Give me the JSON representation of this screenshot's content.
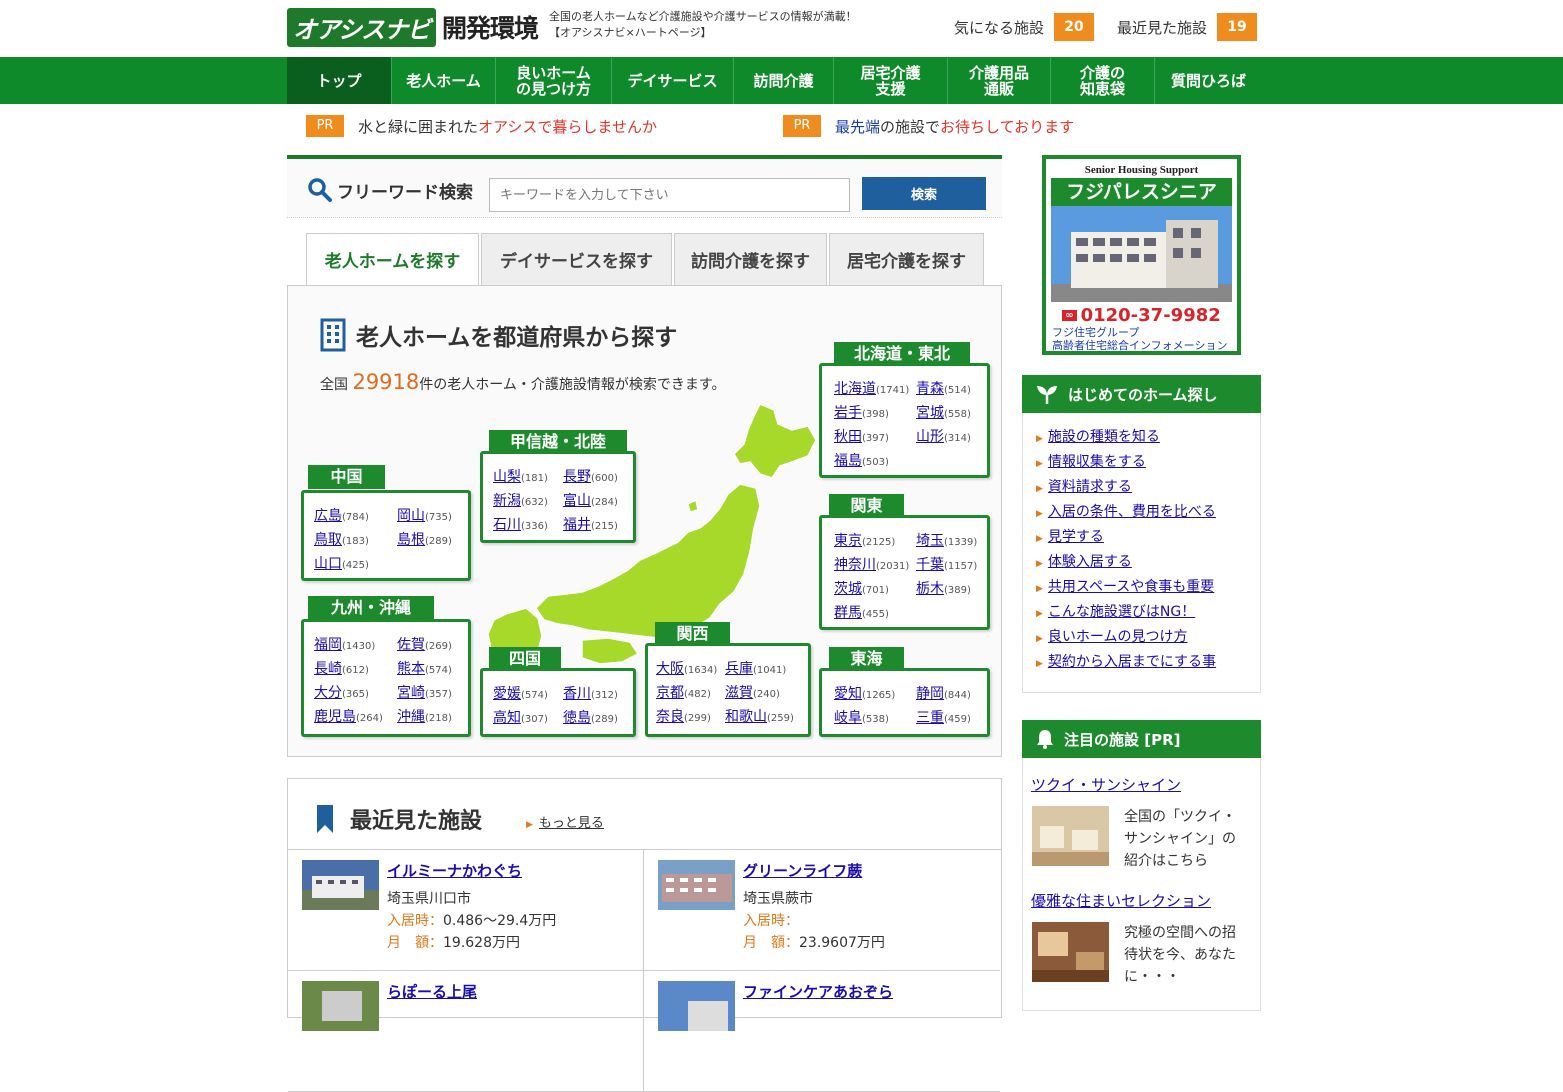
{
  "header": {
    "logo_brand": "オアシスナビ",
    "logo_env": "開発環境",
    "desc_line1": "全国の老人ホームなど介護施設や介護サービスの情報が満載！",
    "desc_line2": "【オアシスナビ×ハートページ】",
    "favorites_label": "気になる施設",
    "favorites_count": "20",
    "recent_label": "最近見た施設",
    "recent_count": "19"
  },
  "nav": [
    {
      "l1": "トップ",
      "l2": ""
    },
    {
      "l1": "老人ホーム",
      "l2": ""
    },
    {
      "l1": "良いホーム",
      "l2": "の見つけ方"
    },
    {
      "l1": "デイサービス",
      "l2": ""
    },
    {
      "l1": "訪問介護",
      "l2": ""
    },
    {
      "l1": "居宅介護",
      "l2": "支援"
    },
    {
      "l1": "介護用品",
      "l2": "通販"
    },
    {
      "l1": "介護の",
      "l2": "知恵袋"
    },
    {
      "l1": "質問ひろば",
      "l2": ""
    }
  ],
  "pr": [
    {
      "tag": "PR",
      "pre": "水と緑に囲まれた",
      "hl": "オアシスで暮らしませんか",
      "post": ""
    },
    {
      "tag": "PR",
      "pre": "最先端",
      "mid": "の施設で",
      "hl": "お待ちしております"
    }
  ],
  "search": {
    "label": "フリーワード検索",
    "placeholder": "キーワードを入力して下さい",
    "button": "検索"
  },
  "tabs": [
    "老人ホームを探す",
    "デイサービスを探す",
    "訪問介護を探す",
    "居宅介護を探す"
  ],
  "map": {
    "title": "老人ホームを都道府県から探す",
    "count_pre": "全国",
    "count": "29918",
    "count_post": "件の老人ホーム・介護施設情報が検索できます。",
    "regions": {
      "hokkaido": {
        "name": "北海道・東北",
        "prefs": [
          [
            "北海道",
            "(1741)"
          ],
          [
            "青森",
            "(514)"
          ],
          [
            "岩手",
            "(398)"
          ],
          [
            "宮城",
            "(558)"
          ],
          [
            "秋田",
            "(397)"
          ],
          [
            "山形",
            "(314)"
          ],
          [
            "福島",
            "(503)"
          ]
        ]
      },
      "kanto": {
        "name": "関東",
        "prefs": [
          [
            "東京",
            "(2125)"
          ],
          [
            "埼玉",
            "(1339)"
          ],
          [
            "神奈川",
            "(2031)"
          ],
          [
            "千葉",
            "(1157)"
          ],
          [
            "茨城",
            "(701)"
          ],
          [
            "栃木",
            "(389)"
          ],
          [
            "群馬",
            "(455)"
          ]
        ]
      },
      "tokai": {
        "name": "東海",
        "prefs": [
          [
            "愛知",
            "(1265)"
          ],
          [
            "静岡",
            "(844)"
          ],
          [
            "岐阜",
            "(538)"
          ],
          [
            "三重",
            "(459)"
          ]
        ]
      },
      "koshin": {
        "name": "甲信越・北陸",
        "prefs": [
          [
            "山梨",
            "(181)"
          ],
          [
            "長野",
            "(600)"
          ],
          [
            "新潟",
            "(632)"
          ],
          [
            "富山",
            "(284)"
          ],
          [
            "石川",
            "(336)"
          ],
          [
            "福井",
            "(215)"
          ]
        ]
      },
      "kansai": {
        "name": "関西",
        "prefs": [
          [
            "大阪",
            "(1634)"
          ],
          [
            "兵庫",
            "(1041)"
          ],
          [
            "京都",
            "(482)"
          ],
          [
            "滋賀",
            "(240)"
          ],
          [
            "奈良",
            "(299)"
          ],
          [
            "和歌山",
            "(259)"
          ]
        ]
      },
      "chugoku": {
        "name": "中国",
        "prefs": [
          [
            "広島",
            "(784)"
          ],
          [
            "岡山",
            "(735)"
          ],
          [
            "鳥取",
            "(183)"
          ],
          [
            "島根",
            "(289)"
          ],
          [
            "山口",
            "(425)"
          ]
        ]
      },
      "shikoku": {
        "name": "四国",
        "prefs": [
          [
            "愛媛",
            "(574)"
          ],
          [
            "香川",
            "(312)"
          ],
          [
            "高知",
            "(307)"
          ],
          [
            "徳島",
            "(289)"
          ]
        ]
      },
      "kyushu": {
        "name": "九州・沖縄",
        "prefs": [
          [
            "福岡",
            "(1430)"
          ],
          [
            "佐賀",
            "(269)"
          ],
          [
            "長崎",
            "(612)"
          ],
          [
            "熊本",
            "(574)"
          ],
          [
            "大分",
            "(365)"
          ],
          [
            "宮崎",
            "(357)"
          ],
          [
            "鹿児島",
            "(264)"
          ],
          [
            "沖縄",
            "(218)"
          ]
        ]
      }
    }
  },
  "recent": {
    "title": "最近見た施設",
    "more": "もっと見る",
    "items": [
      {
        "name": "イルミーナかわぐち",
        "addr": "埼玉県川口市",
        "move_label": "入居時：",
        "move": "0.486〜29.4万円",
        "month_label": "月　額：",
        "month": "19.628万円"
      },
      {
        "name": "グリーンライフ蕨",
        "addr": "埼玉県蕨市",
        "move_label": "入居時：",
        "move": "",
        "month_label": "月　額：",
        "month": "23.9607万円"
      },
      {
        "name": "らぽーる上尾",
        "addr": "",
        "move_label": "",
        "move": "",
        "month_label": "",
        "month": ""
      },
      {
        "name": "ファインケアあおぞら",
        "addr": "",
        "move_label": "",
        "move": "",
        "month_label": "",
        "month": ""
      }
    ]
  },
  "ad": {
    "sub": "Senior Housing Support",
    "title": "フジパレスシニア",
    "tel": "0120-37-9982",
    "line1": "フジ住宅グループ",
    "line2": "高齢者住宅総合インフォメーション"
  },
  "first_time": {
    "title": "はじめてのホーム探し",
    "links": [
      "施設の種類を知る",
      "情報収集をする",
      "資料請求する",
      "入居の条件、費用を比べる",
      "見学する",
      "体験入居する",
      "共用スペースや食事も重要",
      "こんな施設選びはNG！",
      "良いホームの見つけ方",
      "契約から入居までにする事"
    ]
  },
  "featured": {
    "title": "注目の施設 [PR]",
    "items": [
      {
        "name": "ツクイ・サンシャイン",
        "text": "全国の「ツクイ・サンシャイン」の紹介はこちら"
      },
      {
        "name": "優雅な住まいセレクション",
        "text": "究極の空間への招待状を今、あなたに・・・"
      }
    ]
  },
  "colors": {
    "brand_green": "#1e8a2e",
    "nav_green": "#0f8a2b",
    "accent_orange": "#f08c1e",
    "search_blue": "#1f5f9e",
    "map_green": "#a6d92a"
  }
}
